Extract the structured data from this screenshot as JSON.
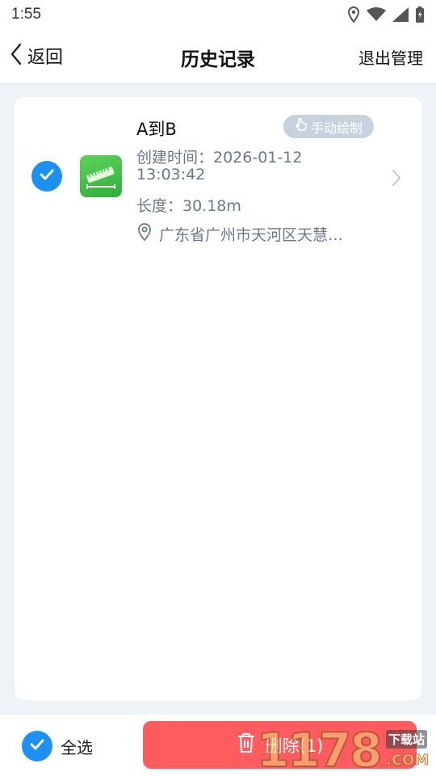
{
  "status_bar": {
    "time": "1:55",
    "icons": [
      "location-icon",
      "wifi-icon",
      "signal-icon",
      "battery-icon"
    ]
  },
  "header": {
    "back_label": "返回",
    "title": "历史记录",
    "exit_label": "退出管理"
  },
  "records": [
    {
      "title": "A到B",
      "tag": "手动绘制",
      "created_time_line1": "创建时间：2026-01-12",
      "created_time_line2": "13:03:42",
      "length": "长度：30.18m",
      "address": "广东省广州市天河区天慧…",
      "selected": true,
      "thumb_icon": "ruler-icon"
    }
  ],
  "bottom_bar": {
    "select_all_label": "全选",
    "delete_label": "删除(1)"
  },
  "watermark": {
    "logo": "1178",
    "badge": "下载站",
    "suffix": ".COM"
  },
  "colors": {
    "accent": "#1e90f2",
    "delete": "#fe5c5e",
    "tag_bg": "#c8d2df",
    "page_bg": "#eef3f8",
    "secondary_text": "#6d7889"
  }
}
